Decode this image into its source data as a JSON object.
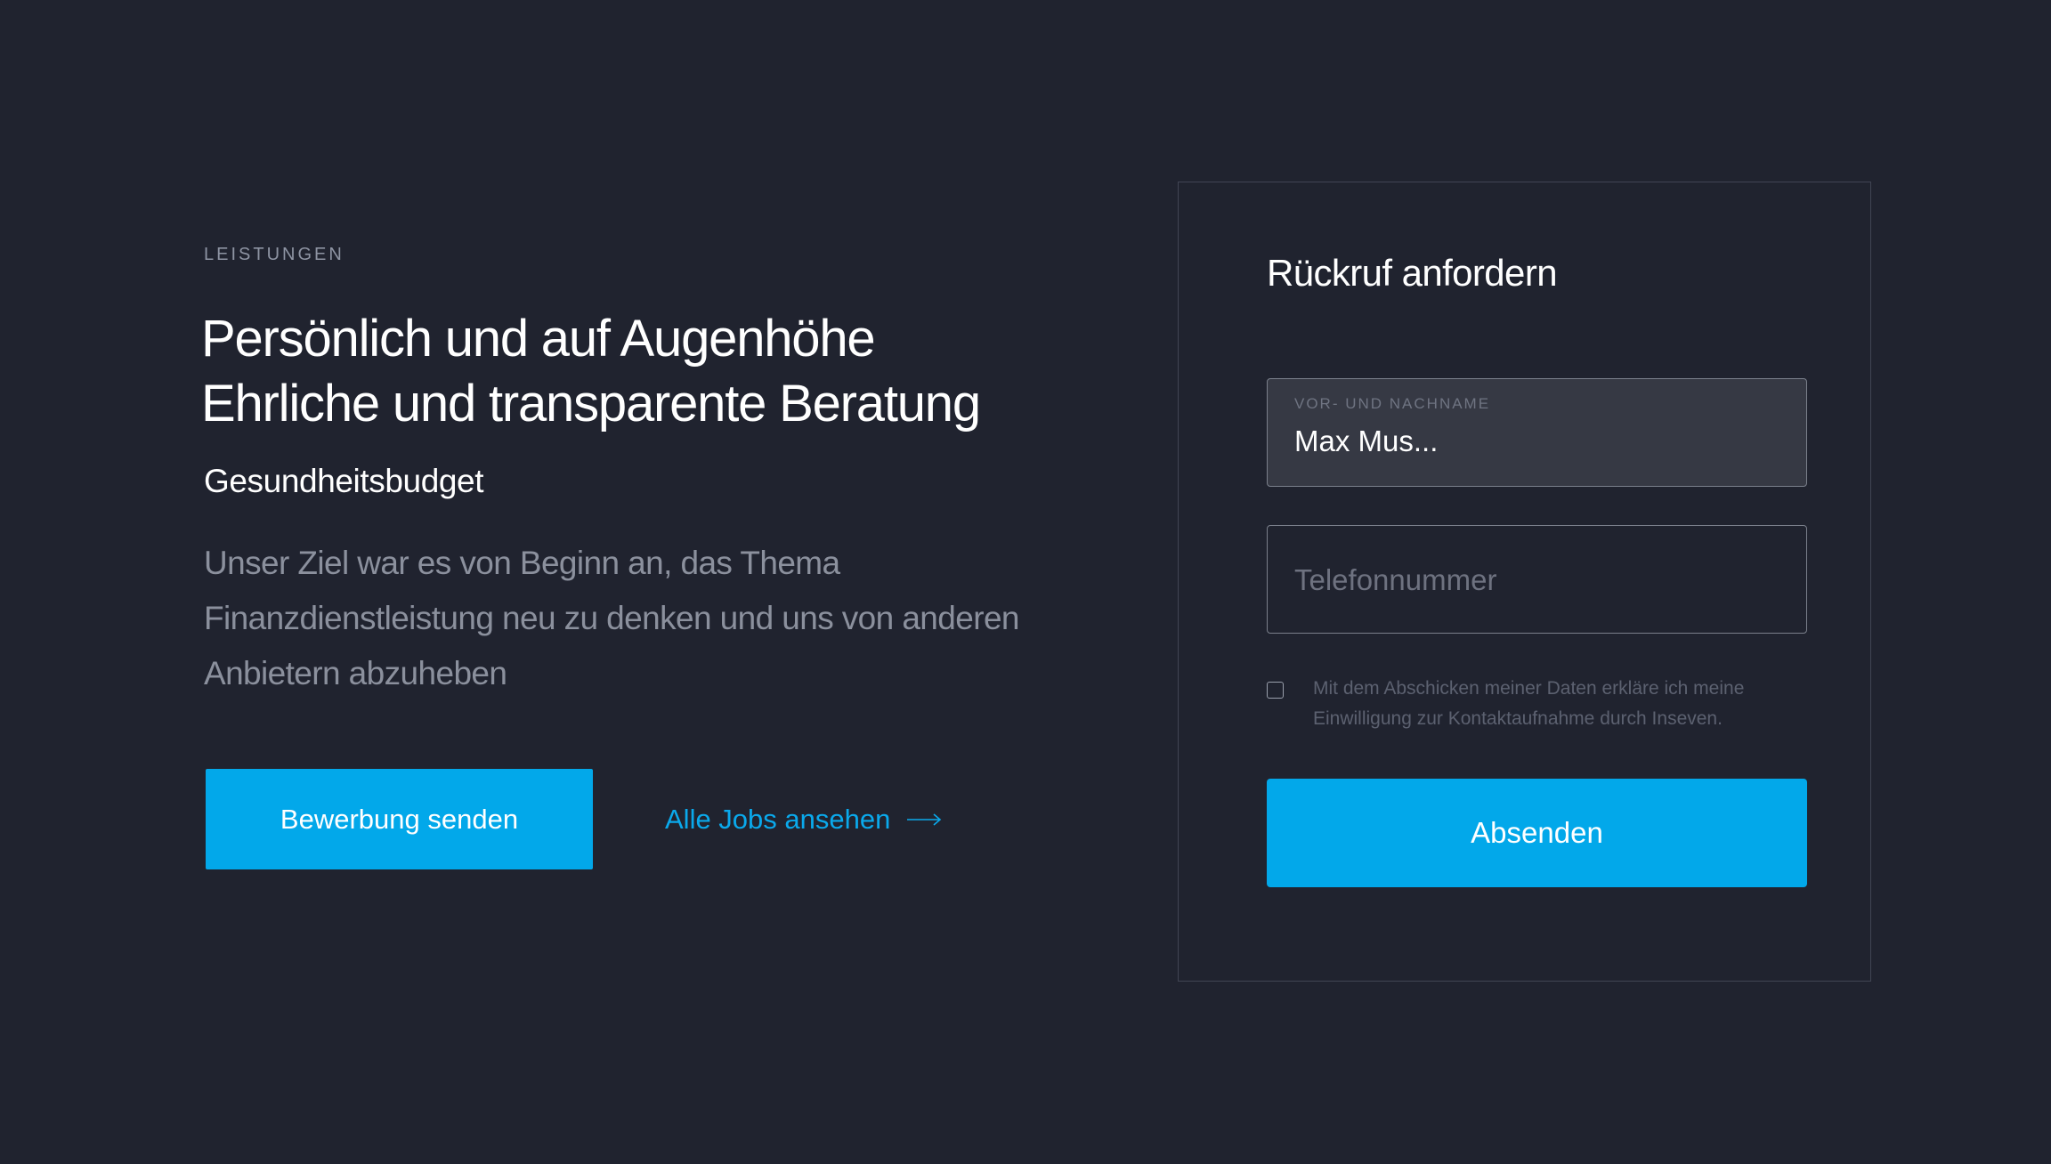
{
  "hero": {
    "eyebrow": "LEISTUNGEN",
    "headline_line1": "Persönlich und auf Augenhöhe",
    "headline_line2": "Ehrliche und transparente Beratung",
    "subheading": "Gesundheitsbudget",
    "body": "Unser Ziel war es von Beginn an, das Thema Finanzdienstleistung neu zu denken und uns von an­deren Anbietern abzuheben",
    "primary_button": "Bewerbung senden",
    "link_label": "Alle Jobs ansehen",
    "link_icon": "arrow-right-icon"
  },
  "form": {
    "title": "Rückruf anfordern",
    "name_field": {
      "label": "VOR- UND NACHNAME",
      "value": "Max Mus..."
    },
    "phone_field": {
      "placeholder": "Telefonnummer",
      "value": ""
    },
    "consent": {
      "checked": false,
      "text": "Mit dem Abschicken meiner Daten erkläre ich meine Einwilligung zur Kontaktaufnahme durch Inseven."
    },
    "submit_label": "Absenden"
  },
  "colors": {
    "background": "#20232f",
    "accent": "#02a8ea",
    "muted_text": "#8b909d",
    "card_border": "#414554"
  }
}
